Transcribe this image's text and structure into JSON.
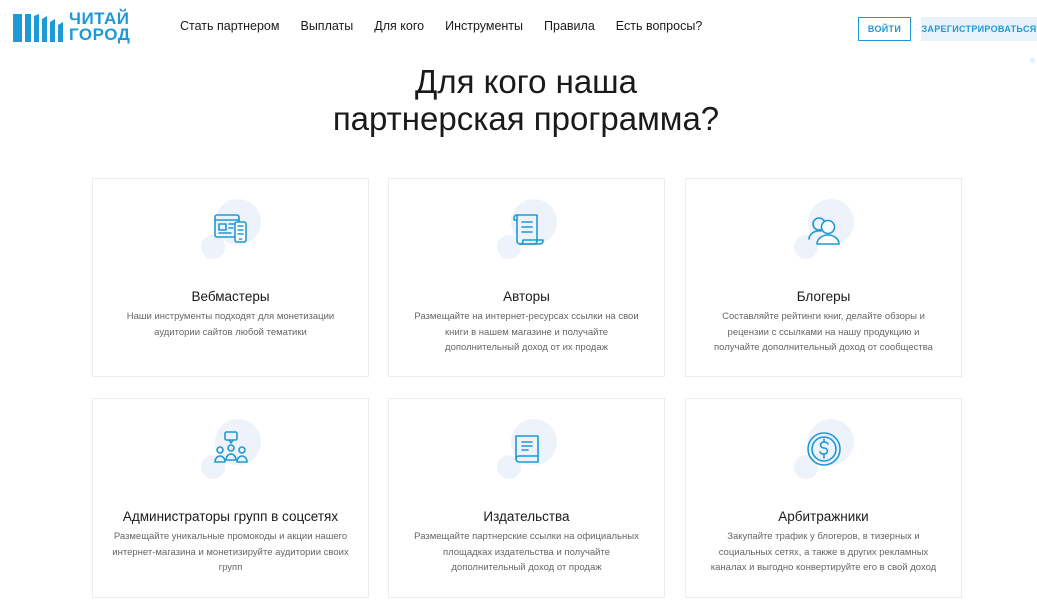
{
  "logo": {
    "line1": "ЧИТАЙ",
    "line2": "ГОРОД",
    "color": "#1d9ad6"
  },
  "nav": [
    "Стать партнером",
    "Выплаты",
    "Для кого",
    "Инструменты",
    "Правила",
    "Есть вопросы?"
  ],
  "auth": {
    "login": "ВОЙТИ",
    "register": "ЗАРЕГИСТРИРОВАТЬСЯ"
  },
  "hero": {
    "line1": "Для кого наша",
    "line2": "партнерская программа?"
  },
  "cards": [
    {
      "icon": "browser-mobile-icon",
      "title": "Вебмастеры",
      "desc": "Наши инструменты подходят для монетизации аудитории сайтов любой тематики"
    },
    {
      "icon": "scroll-document-icon",
      "title": "Авторы",
      "desc": "Размещайте на интернет-ресурсах ссылки на свои книги в нашем магазине и получайте дополнительный доход от их продаж"
    },
    {
      "icon": "users-icon",
      "title": "Блогеры",
      "desc": "Составляйте рейтинги книг, делайте обзоры и рецензии с ссылками на нашу продукцию и получайте дополнительный доход от сообщества"
    },
    {
      "icon": "group-chat-icon",
      "title": "Администраторы групп в соцсетях",
      "desc": "Размещайте уникальные промокоды и акции нашего интернет-магазина и монетизируйте аудитории своих групп"
    },
    {
      "icon": "book-icon",
      "title": "Издательства",
      "desc": "Размещайте партнерские ссылки на официальных площадках издательства и получайте дополнительный доход от продаж"
    },
    {
      "icon": "dollar-coin-icon",
      "title": "Арбитражники",
      "desc": "Закупайте трафик у блогеров, в тизерных и социальных сетях, а также в других рекламных каналах и выгодно конвертируйте его в свой доход"
    }
  ],
  "colors": {
    "accent": "#1d9ad6",
    "bubble": "#eef3fb",
    "card_border": "#ececec"
  }
}
